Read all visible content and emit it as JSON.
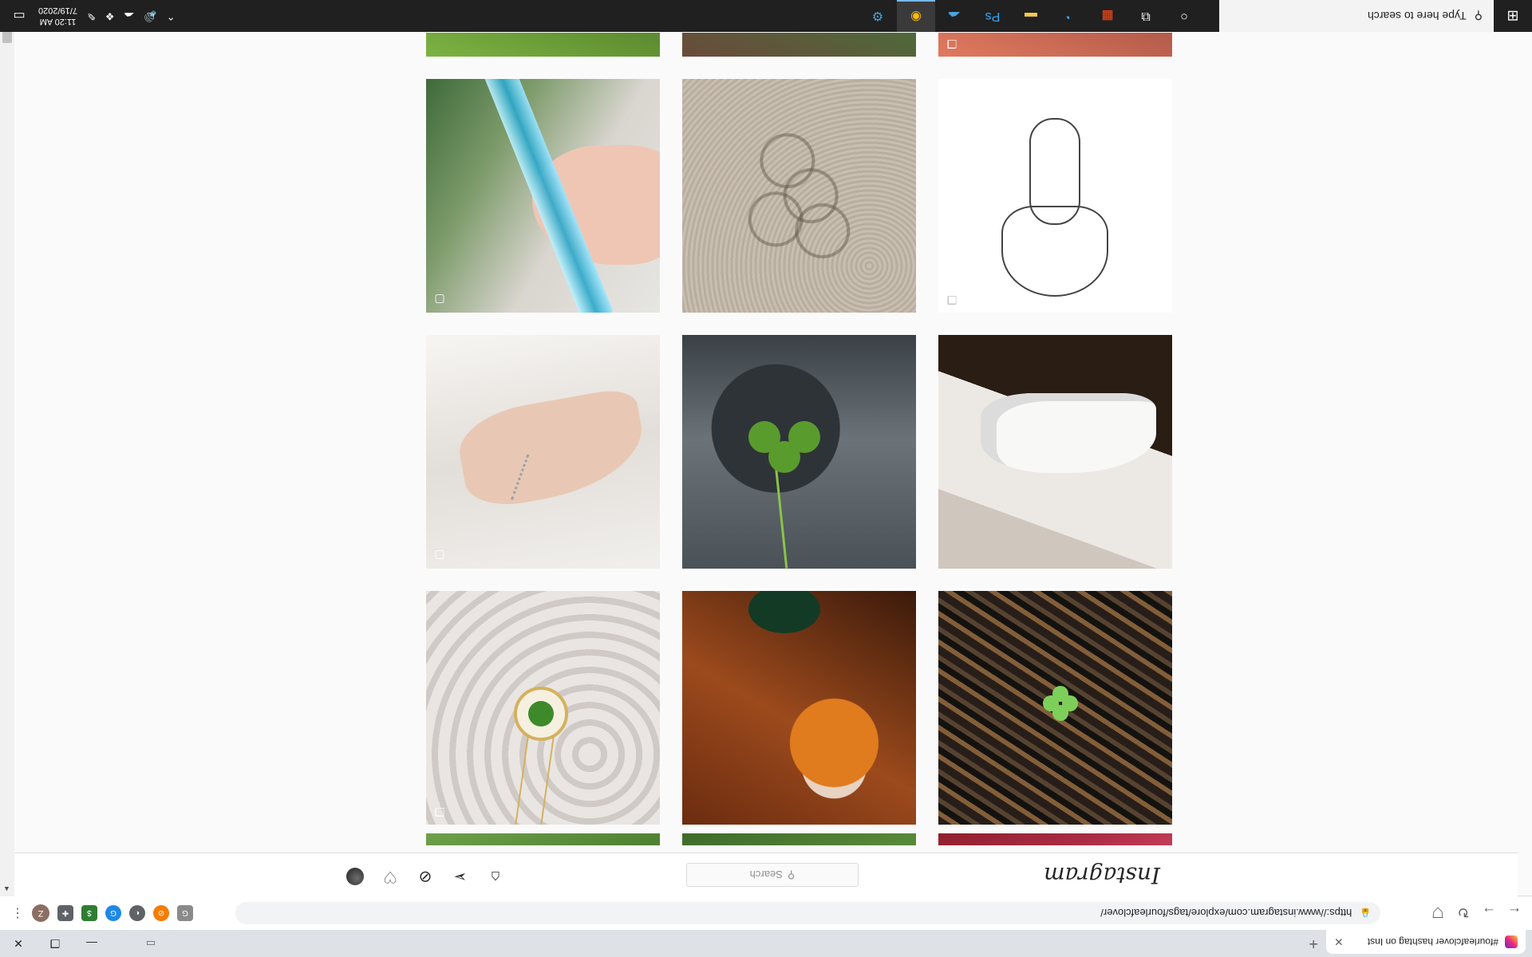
{
  "browser": {
    "tab_title": "#fourleafclover hashtag on Inst",
    "url": "https://www.instagram.com/explore/tags/fourleafclover/",
    "avatar_letter": "Z"
  },
  "instagram": {
    "logo": "Instagram",
    "search_placeholder": "Search"
  },
  "taskbar": {
    "search_placeholder": "Type here to search",
    "time": "11:20 AM",
    "date": "7/19/2020"
  },
  "icons": {
    "start": "windows-logo-icon",
    "search": "search-icon",
    "cortana": "circle-icon",
    "taskview": "task-view-icon"
  },
  "colors": {
    "instagram_border": "#dbdbdb",
    "taskbar_bg": "#202020",
    "accent": "#76b9ed"
  }
}
